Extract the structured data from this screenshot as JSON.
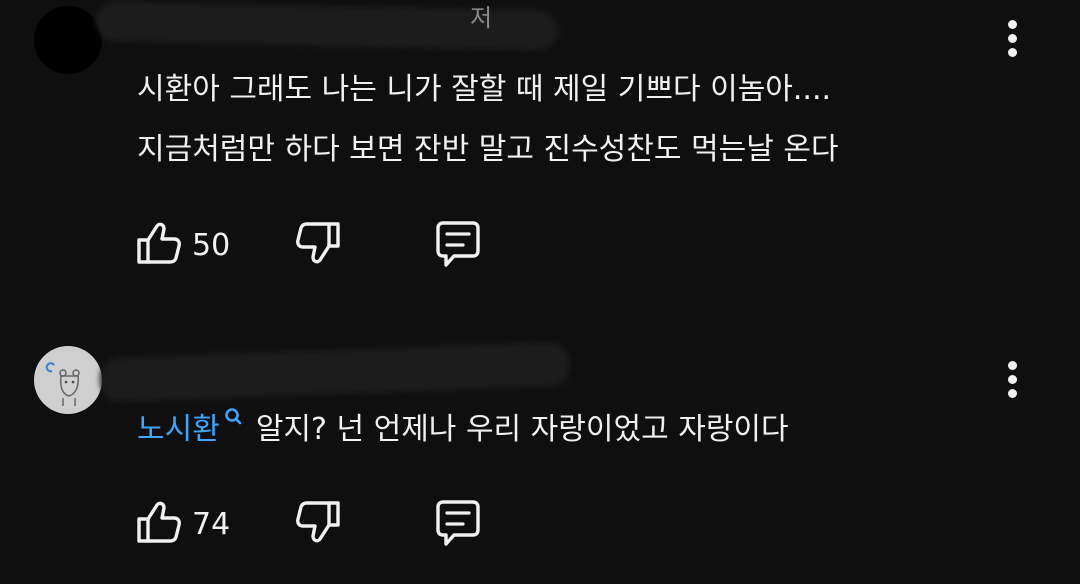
{
  "comments": [
    {
      "redacted_name_glyph": "저",
      "text_lines": [
        "시환아 그래도 나는 니가 잘할 때 제일 기쁘다 이놈아....",
        "지금처럼만 하다 보면 잔반 말고 진수성찬도 먹는날 온다"
      ],
      "like_count": "50"
    },
    {
      "mention": "노시환",
      "mention_icon": "search-icon",
      "text": "알지? 넌 언제나 우리 자랑이었고 자랑이다",
      "like_count": "74"
    }
  ],
  "icons": {
    "like": "thumbs-up-icon",
    "dislike": "thumbs-down-icon",
    "reply": "comment-icon",
    "more": "more-vertical-icon"
  },
  "colors": {
    "background": "#0f0f0f",
    "text": "#f1f1f1",
    "mention": "#3ea6ff"
  }
}
